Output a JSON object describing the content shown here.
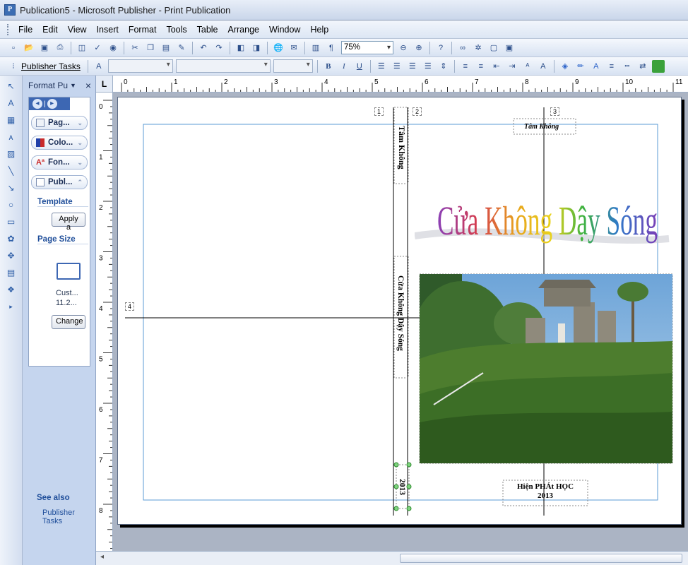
{
  "window": {
    "title": "Publication5 - Microsoft Publisher - Print Publication",
    "app_icon": "publisher-icon"
  },
  "menu": [
    "File",
    "Edit",
    "View",
    "Insert",
    "Format",
    "Tools",
    "Table",
    "Arrange",
    "Window",
    "Help"
  ],
  "toolbar": {
    "zoom": "75%",
    "tasks_label": "Publisher Tasks"
  },
  "taskpane": {
    "title": "Format Pu",
    "sections": [
      "Pag...",
      "Colo...",
      "Fon...",
      "Publ..."
    ],
    "template_label": "Template",
    "apply_button": "Apply a",
    "page_size_label": "Page Size",
    "page_size_name": "Cust...",
    "page_size_value": "11.2...",
    "change_button": "Change",
    "see_also": "See also",
    "publisher_tasks_link": "Publisher Tasks"
  },
  "ruler": {
    "corner": "L",
    "h_numbers": [
      "0",
      "1",
      "2",
      "3",
      "4",
      "5",
      "6",
      "7",
      "8",
      "9",
      "10",
      "11"
    ],
    "v_numbers": [
      "0",
      "1",
      "2",
      "3",
      "4",
      "5",
      "6",
      "7",
      "8"
    ]
  },
  "document": {
    "guide_labels": [
      "1",
      "2",
      "3",
      "4"
    ],
    "spine_top": "Tâm Không",
    "spine_middle": "Cửa Không Dậy Sóng",
    "spine_bottom": "2013",
    "author_top": "Tâm Không",
    "wordart_title": "Cửa Không Dậy Sóng",
    "footer_line1": "Hiện PHÁt HỌC",
    "footer_line2": "2013"
  }
}
